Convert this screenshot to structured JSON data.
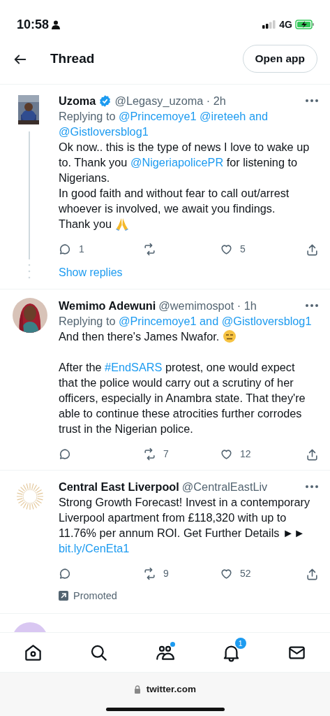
{
  "status_bar": {
    "time": "10:58",
    "network": "4G"
  },
  "header": {
    "title": "Thread",
    "button": "Open app"
  },
  "tweets": [
    {
      "kind": "reply",
      "name": "Uzoma",
      "verified": true,
      "handle": "@Legasy_uzoma · 2h",
      "thread_line": true,
      "replying": [
        {
          "kind": "plain",
          "text": "Replying to "
        },
        {
          "kind": "blue",
          "text": "@Princemoye1 @ireteeh and @Gistloversblog1"
        }
      ],
      "paragraphs": [
        [
          {
            "kind": "plain",
            "text": "Ok now.. this is the type of news I love to wake up to. Thank you "
          },
          {
            "kind": "link",
            "text": "@NigeriapolicePR"
          },
          {
            "kind": "plain",
            "text": " for listening to Nigerians."
          }
        ],
        [
          {
            "kind": "plain",
            "text": "In good faith and without fear to call out/arrest whoever is involved, we await you findings."
          }
        ],
        [
          {
            "kind": "plain",
            "text": "Thank you "
          },
          {
            "kind": "pray"
          }
        ]
      ],
      "actions": {
        "reply": "1",
        "like": "5"
      },
      "show_replies": "Show replies"
    },
    {
      "kind": "reply",
      "name": "Wemimo Adewuni",
      "verified": false,
      "handle": "@wemimospot · 1h",
      "thread_line": false,
      "replying": [
        {
          "kind": "plain",
          "text": "Replying to "
        },
        {
          "kind": "blue",
          "text": "@Princemoye1 and @Gistloversblog1"
        }
      ],
      "paragraphs": [
        [
          {
            "kind": "plain",
            "text": "And then there's James Nwafor. "
          },
          {
            "kind": "expressionless"
          }
        ],
        [
          {
            "kind": "plain",
            "text": "After the "
          },
          {
            "kind": "link",
            "text": "#EndSARS"
          },
          {
            "kind": "plain",
            "text": " protest, one would expect that the police would carry out a scrutiny of her officers, especially in Anambra state. That they're able to continue these atrocities further corrodes trust in the Nigerian police."
          }
        ]
      ],
      "actions": {
        "retweet": "7",
        "like": "12"
      }
    },
    {
      "kind": "ad",
      "name": "Central East Liverpool",
      "verified": false,
      "handle": "@CentralEastLiv",
      "thread_line": false,
      "paragraphs": [
        [
          {
            "kind": "plain",
            "text": "Strong Growth Forecast! Invest in a contemporary Liverpool apartment from £118,320 with up to 11.76% per annum ROI. Get Further Details ►►"
          }
        ],
        [
          {
            "kind": "link",
            "text": "bit.ly/CenEta1"
          }
        ]
      ],
      "actions": {
        "retweet": "9",
        "like": "52"
      },
      "promoted": "Promoted"
    },
    {
      "kind": "cut_off"
    }
  ],
  "nav": [
    {
      "kind": "home",
      "dot": false
    },
    {
      "kind": "search",
      "dot": false
    },
    {
      "kind": "communities",
      "dot": true
    },
    {
      "kind": "notifications",
      "dot": false,
      "badge": "1"
    },
    {
      "kind": "messages",
      "dot": false
    }
  ],
  "url": "twitter.com"
}
